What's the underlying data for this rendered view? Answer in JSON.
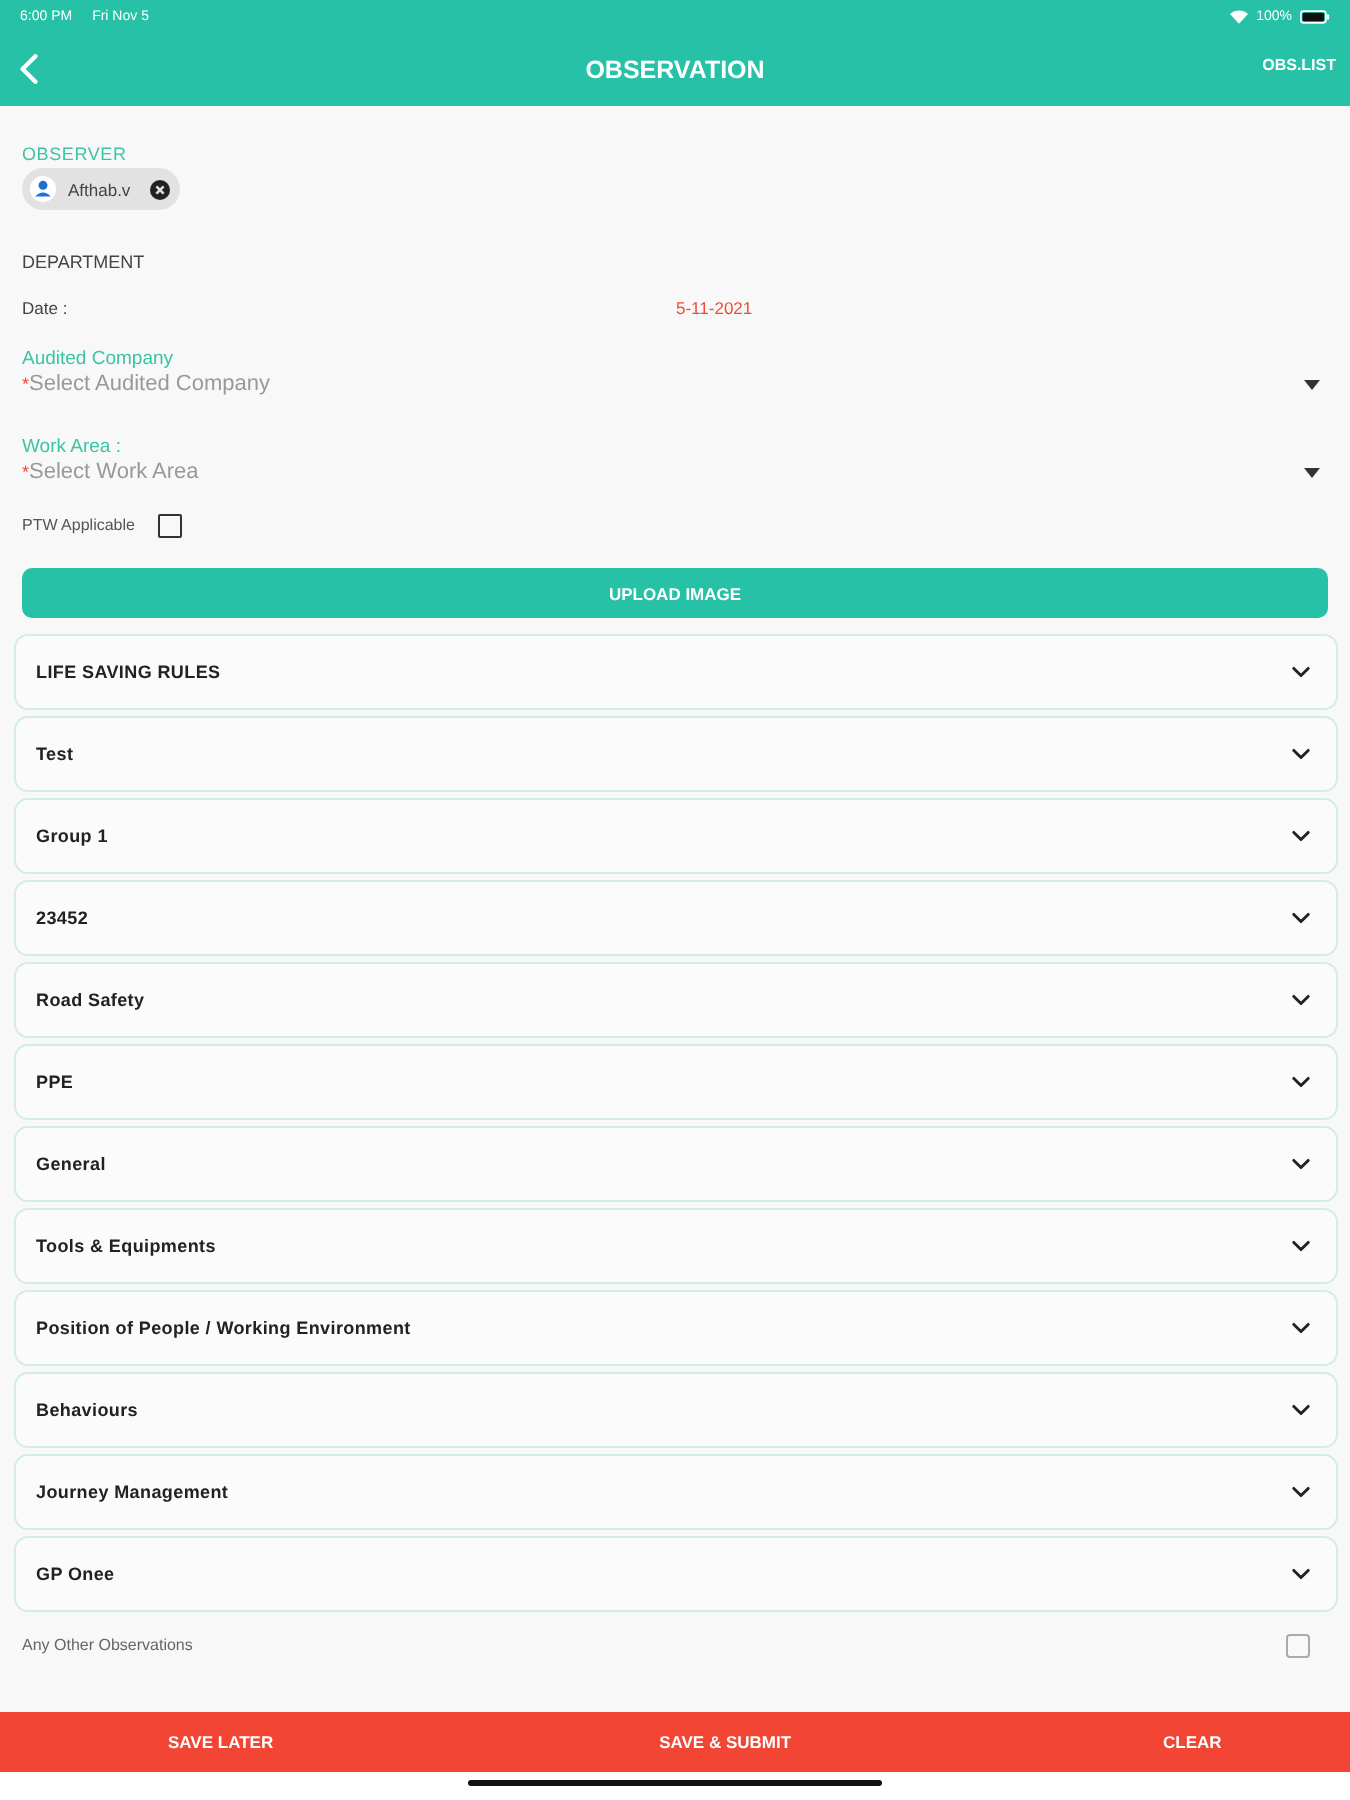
{
  "status_bar": {
    "time": "6:00 PM",
    "date": "Fri Nov 5",
    "battery": "100%"
  },
  "nav": {
    "title": "OBSERVATION",
    "action": "OBS.LIST"
  },
  "observer": {
    "label": "OBSERVER",
    "chips": [
      {
        "name": "Afthab.v"
      }
    ]
  },
  "department": {
    "label": "DEPARTMENT"
  },
  "date": {
    "label": "Date :",
    "value": "5-11-2021"
  },
  "fields": [
    {
      "label": "Audited Company",
      "required_mark": "*",
      "placeholder": "Select Audited Company"
    },
    {
      "label": "Work Area :",
      "required_mark": "*",
      "placeholder": "Select Work Area"
    }
  ],
  "ptw": {
    "label": "PTW Applicable",
    "checked": false
  },
  "upload_button": "UPLOAD IMAGE",
  "sections": [
    {
      "title": "LIFE SAVING RULES",
      "expanded": false
    },
    {
      "title": "Test",
      "expanded": false
    },
    {
      "title": "Group 1",
      "expanded": false
    },
    {
      "title": "23452",
      "expanded": false
    },
    {
      "title": "Road Safety",
      "expanded": false
    },
    {
      "title": "PPE",
      "expanded": false
    },
    {
      "title": "General",
      "expanded": false
    },
    {
      "title": "Tools & Equipments",
      "expanded": false
    },
    {
      "title": "Position of People / Working Environment",
      "expanded": false
    },
    {
      "title": "Behaviours",
      "expanded": false
    },
    {
      "title": "Journey Management",
      "expanded": false
    },
    {
      "title": "GP Onee",
      "expanded": false
    }
  ],
  "other_observations": {
    "label": "Any Other Observations",
    "checked": false
  },
  "footer_buttons": [
    "SAVE LATER",
    "SAVE & SUBMIT",
    "CLEAR"
  ]
}
